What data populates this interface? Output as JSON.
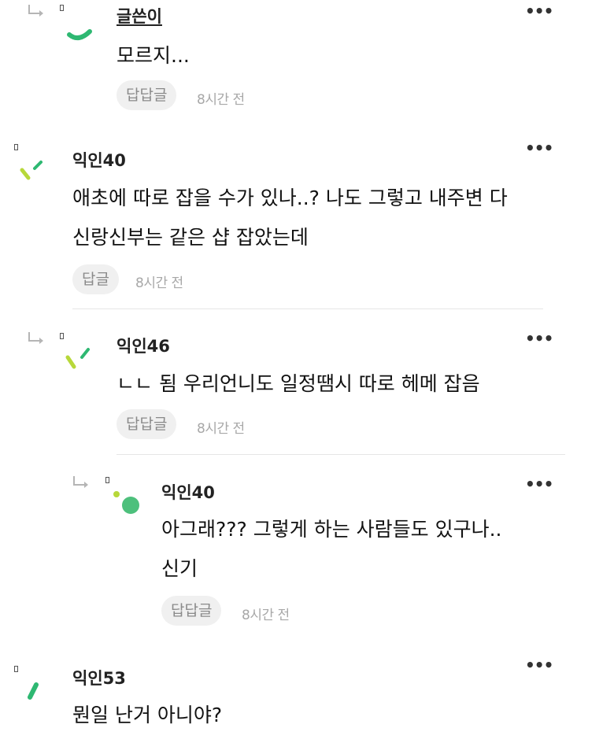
{
  "more_label": "•••",
  "comments": [
    {
      "nickname": "글쓴이",
      "lines": [
        "모르지..."
      ],
      "reply_label": "답답글",
      "time": "8시간 전"
    },
    {
      "nickname": "익인40",
      "lines": [
        "애초에 따로 잡을 수가 있나..? 나도 그렇고 내주변 다",
        "신랑신부는 같은 샵 잡았는데"
      ],
      "reply_label": "답글",
      "time": "8시간 전"
    },
    {
      "nickname": "익인46",
      "lines": [
        "ㄴㄴ 됨 우리언니도 일정땜시 따로 헤메 잡음"
      ],
      "reply_label": "답답글",
      "time": "8시간 전"
    },
    {
      "nickname": "익인40",
      "lines": [
        "아그래??? 그렇게 하는 사람들도 있구나..",
        "신기"
      ],
      "reply_label": "답답글",
      "time": "8시간 전"
    },
    {
      "nickname": "익인53",
      "lines": [
        "뭔일 난거 아니야?"
      ]
    }
  ],
  "colors": {
    "avatar_green": "#2eb872",
    "avatar_lime": "#b7d83a",
    "avatar_mint": "#4dc07c"
  }
}
